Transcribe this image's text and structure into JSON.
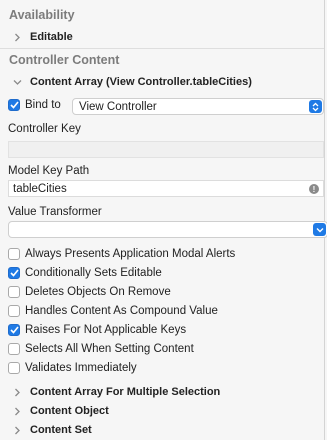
{
  "sections": {
    "availability": {
      "title": "Availability",
      "editable_label": "Editable"
    },
    "controller_content": {
      "title": "Controller Content"
    }
  },
  "content_array": {
    "title": "Content Array (View Controller.tableCities)",
    "bind_to_label": "Bind to",
    "bind_to_checked": true,
    "bind_to_value": "View Controller",
    "controller_key_label": "Controller Key",
    "controller_key_value": "",
    "model_key_path_label": "Model Key Path",
    "model_key_path_value": "tableCities",
    "value_transformer_label": "Value Transformer",
    "value_transformer_value": "",
    "options": [
      {
        "label": "Always Presents Application Modal Alerts",
        "checked": false
      },
      {
        "label": "Conditionally Sets Editable",
        "checked": true
      },
      {
        "label": "Deletes Objects On Remove",
        "checked": false
      },
      {
        "label": "Handles Content As Compound Value",
        "checked": false
      },
      {
        "label": "Raises For Not Applicable Keys",
        "checked": true
      },
      {
        "label": "Selects All When Setting Content",
        "checked": false
      },
      {
        "label": "Validates Immediately",
        "checked": false
      }
    ]
  },
  "collapsed_groups": [
    "Content Array For Multiple Selection",
    "Content Object",
    "Content Set"
  ],
  "colors": {
    "accent": "#1f7ae5",
    "section_header": "#7c7c7c"
  }
}
